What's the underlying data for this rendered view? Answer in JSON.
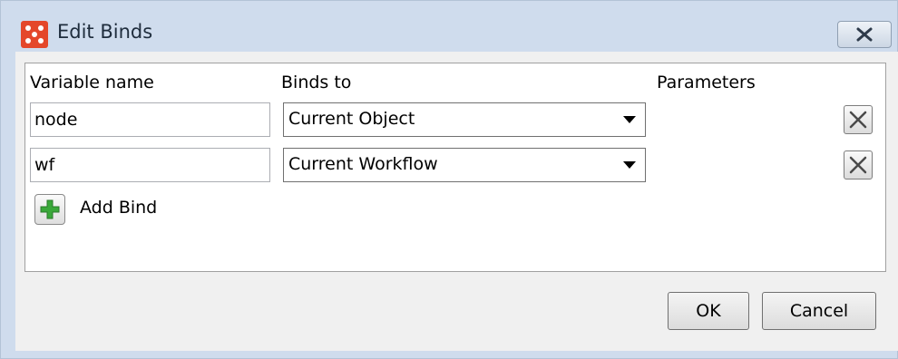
{
  "window": {
    "title": "Edit Binds"
  },
  "table": {
    "headers": {
      "variable_name": "Variable name",
      "binds_to": "Binds to",
      "parameters": "Parameters"
    },
    "rows": [
      {
        "variable": "node",
        "binds_to": "Current Object"
      },
      {
        "variable": "wf",
        "binds_to": "Current Workflow"
      }
    ]
  },
  "add_bind": {
    "label": "Add Bind"
  },
  "buttons": {
    "ok": "OK",
    "cancel": "Cancel"
  },
  "icons": {
    "app": "app-grid-icon",
    "close": "close-icon",
    "delete": "delete-x-icon",
    "add": "green-plus-icon"
  },
  "colors": {
    "app_icon": "#e4472a",
    "add_icon": "#3aa83a",
    "window_frame": "#cfdced"
  }
}
